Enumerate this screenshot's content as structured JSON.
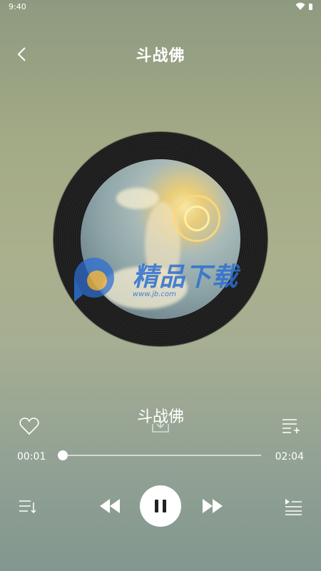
{
  "status_bar": {
    "time": "9:40"
  },
  "header": {
    "title": "斗战佛"
  },
  "watermark": {
    "brand": "精品下载",
    "url": "www.jb.com"
  },
  "song": {
    "name": "斗战佛"
  },
  "player": {
    "current_time": "00:01",
    "total_time": "02:04",
    "progress": 0.0,
    "state": "playing"
  },
  "icons": {
    "back": "back-icon",
    "heart": "heart-icon",
    "download": "download-icon",
    "add_to_playlist": "add-to-playlist-icon",
    "play_mode": "play-mode-icon",
    "previous": "previous-icon",
    "pause": "pause-icon",
    "next": "next-icon",
    "queue": "queue-icon"
  }
}
